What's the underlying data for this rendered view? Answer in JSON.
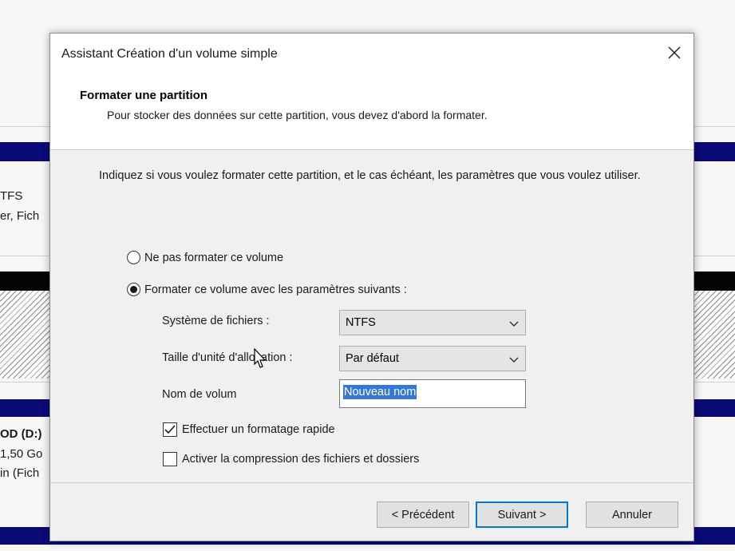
{
  "background": {
    "left_texts": [
      "TFS",
      "er, Fich",
      "OD  (D:)",
      "1,50 Go",
      "in (Fich"
    ]
  },
  "dialog": {
    "title": "Assistant Création d'un volume simple",
    "close_icon": "close-icon",
    "header": {
      "title": "Formater une partition",
      "subtitle": "Pour stocker des données sur cette partition, vous devez d'abord la formater."
    },
    "intro": "Indiquez si vous voulez formater cette partition, et le cas échéant, les paramètres que vous voulez utiliser.",
    "options": {
      "no_format": "Ne pas formater ce volume",
      "format": "Formater ce volume avec les paramètres suivants :",
      "selected": "format"
    },
    "fields": {
      "filesystem_label": "Système de fichiers :",
      "filesystem_value": "NTFS",
      "allocation_label": "Taille d'unité d'allocation :",
      "allocation_value": "Par défaut",
      "volume_label": "Nom de volume :",
      "volume_label_visible": "Nom de volum",
      "volume_value": "Nouveau nom"
    },
    "checkboxes": {
      "quick_format": {
        "label": "Effectuer un formatage rapide",
        "checked": true
      },
      "compression": {
        "label": "Activer la compression des fichiers et dossiers",
        "checked": false
      }
    },
    "buttons": {
      "back": "< Précédent",
      "next": "Suivant >",
      "cancel": "Annuler"
    },
    "accent_color": "#0078d7",
    "selection_color": "#3477d4"
  }
}
